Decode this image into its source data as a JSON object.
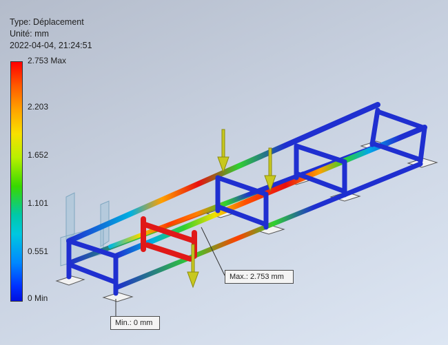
{
  "header": {
    "type_line": "Type: Déplacement",
    "unit_line": "Unité: mm",
    "datetime_line": "2022-04-04, 21:24:51"
  },
  "legend": {
    "max_label": "2.753 Max",
    "ticks": [
      "2.203",
      "1.652",
      "1.101",
      "0.551"
    ],
    "min_label": "0 Min",
    "max_value": 2.753,
    "min_value": 0,
    "colors": [
      "#ff0000",
      "#ffa300",
      "#f8e000",
      "#38d800",
      "#00c8e0",
      "#0088ff",
      "#0010e0"
    ]
  },
  "callouts": {
    "max": "Max.: 2.753 mm",
    "min": "Min.: 0 mm"
  },
  "colors": {
    "frame": "#1f2fd0",
    "frame_dark": "#1420a0",
    "load_arrow": "#c8c81e",
    "support": "#f2f2f2"
  }
}
